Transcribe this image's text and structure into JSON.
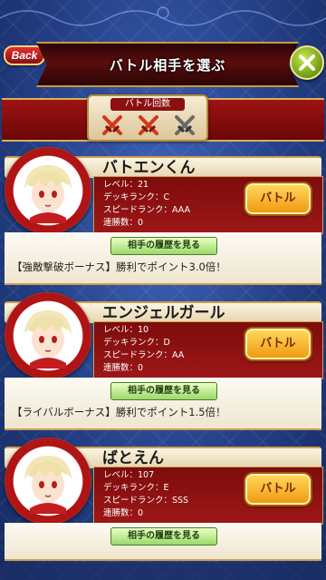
{
  "header": {
    "back_label": "Back",
    "title": "バトル相手を選ぶ"
  },
  "battle_count": {
    "label": "バトル回数",
    "remaining": 2,
    "total": 3
  },
  "opponents": [
    {
      "name": "バトエンくん",
      "level": "レベル：21",
      "deck_rank": "デッキランク：C",
      "speed_rank": "スピードランク：AAA",
      "win_streak": "連勝数：0",
      "battle_label": "バトル",
      "history_label": "相手の履歴を見る",
      "bonus": "【強敵撃破ボーナス】勝利でポイント3.0倍！"
    },
    {
      "name": "エンジェルガール",
      "level": "レベル：10",
      "deck_rank": "デッキランク：D",
      "speed_rank": "スピードランク：AA",
      "win_streak": "連勝数：0",
      "battle_label": "バトル",
      "history_label": "相手の履歴を見る",
      "bonus": "【ライバルボーナス】勝利でポイント1.5倍！"
    },
    {
      "name": "ばとえん",
      "level": "レベル：107",
      "deck_rank": "デッキランク：E",
      "speed_rank": "スピードランク：SSS",
      "win_streak": "連勝数：0",
      "battle_label": "バトル",
      "history_label": "相手の履歴を見る",
      "bonus": ""
    }
  ],
  "colors": {
    "background": "#2a4690",
    "panel_red": "#8b1010",
    "gold_border": "#caa04f",
    "battle_button": "#f5b02a",
    "history_button": "#b9e58a",
    "close_button": "#8cbf1e"
  },
  "icons": [
    "back-button",
    "close-x-icon",
    "crossed-swords-icon",
    "avatar-portrait"
  ]
}
